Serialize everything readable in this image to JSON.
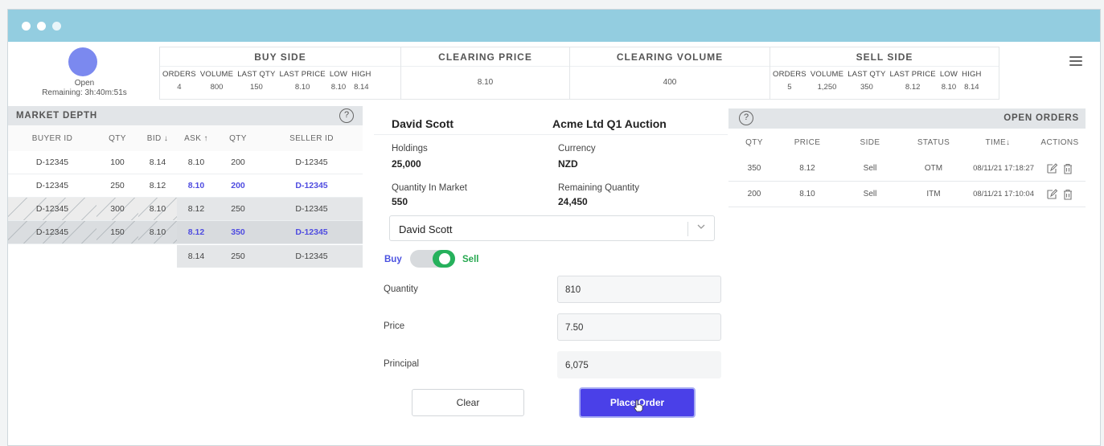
{
  "status": {
    "state": "Open",
    "remaining": "Remaining: 3h:40m:51s"
  },
  "buy_side": {
    "title": "BUY SIDE",
    "stats": [
      {
        "label": "ORDERS",
        "value": "4"
      },
      {
        "label": "VOLUME",
        "value": "800"
      },
      {
        "label": "LAST QTY",
        "value": "150"
      },
      {
        "label": "LAST PRICE",
        "value": "8.10"
      },
      {
        "label": "LOW",
        "value": "8.10"
      },
      {
        "label": "HIGH",
        "value": "8.14"
      }
    ]
  },
  "clearing_price": {
    "title": "CLEARING PRICE",
    "value": "8.10"
  },
  "clearing_volume": {
    "title": "CLEARING VOLUME",
    "value": "400"
  },
  "sell_side": {
    "title": "SELL SIDE",
    "stats": [
      {
        "label": "ORDERS",
        "value": "5"
      },
      {
        "label": "VOLUME",
        "value": "1,250"
      },
      {
        "label": "LAST QTY",
        "value": "350"
      },
      {
        "label": "LAST PRICE",
        "value": "8.12"
      },
      {
        "label": "LOW",
        "value": "8.10"
      },
      {
        "label": "HIGH",
        "value": "8.14"
      }
    ]
  },
  "market_depth": {
    "title": "MARKET DEPTH",
    "help": "?",
    "columns": [
      "BUYER ID",
      "QTY",
      "BID ↓",
      "ASK ↑",
      "QTY",
      "SELLER ID"
    ],
    "rows": [
      {
        "buyer": "D-12345",
        "qty": "100",
        "bid": "8.14",
        "ask": "8.10",
        "qty2": "200",
        "seller": "D-12345"
      },
      {
        "buyer": "D-12345",
        "qty": "250",
        "bid": "8.12",
        "ask": "8.10",
        "qty2": "200",
        "seller": "D-12345"
      },
      {
        "buyer": "D-12345",
        "qty": "300",
        "bid": "8.10",
        "ask": "8.12",
        "qty2": "250",
        "seller": "D-12345"
      },
      {
        "buyer": "D-12345",
        "qty": "150",
        "bid": "8.10",
        "ask": "8.12",
        "qty2": "350",
        "seller": "D-12345"
      },
      {
        "buyer": "",
        "qty": "",
        "bid": "",
        "ask": "8.14",
        "qty2": "250",
        "seller": "D-12345"
      }
    ]
  },
  "order_entry": {
    "trader": "David Scott",
    "auction": "Acme Ltd Q1 Auction",
    "holdings_label": "Holdings",
    "holdings": "25,000",
    "currency_label": "Currency",
    "currency": "NZD",
    "qty_in_market_label": "Quantity In Market",
    "qty_in_market": "550",
    "remaining_qty_label": "Remaining Quantity",
    "remaining_qty": "24,450",
    "account_select": "David Scott",
    "buy_label": "Buy",
    "sell_label": "Sell",
    "quantity_label": "Quantity",
    "quantity": "810",
    "price_label": "Price",
    "price": "7.50",
    "principal_label": "Principal",
    "principal": "6,075",
    "clear_label": "Clear",
    "place_label": "Place Order"
  },
  "open_orders": {
    "title": "OPEN ORDERS",
    "help": "?",
    "columns": [
      "QTY",
      "PRICE",
      "SIDE",
      "STATUS",
      "TIME↓",
      "ACTIONS"
    ],
    "rows": [
      {
        "qty": "350",
        "price": "8.12",
        "side": "Sell",
        "status": "OTM",
        "time": "08/11/21 17:18:27"
      },
      {
        "qty": "200",
        "price": "8.10",
        "side": "Sell",
        "status": "ITM",
        "time": "08/11/21 17:10:04"
      }
    ]
  },
  "colors": {
    "titlebar": "#93cde0",
    "accent": "#4a40e8",
    "highlight": "#4f4ce0",
    "sell_green": "#26b15c",
    "status_dot": "#7b89ef"
  }
}
